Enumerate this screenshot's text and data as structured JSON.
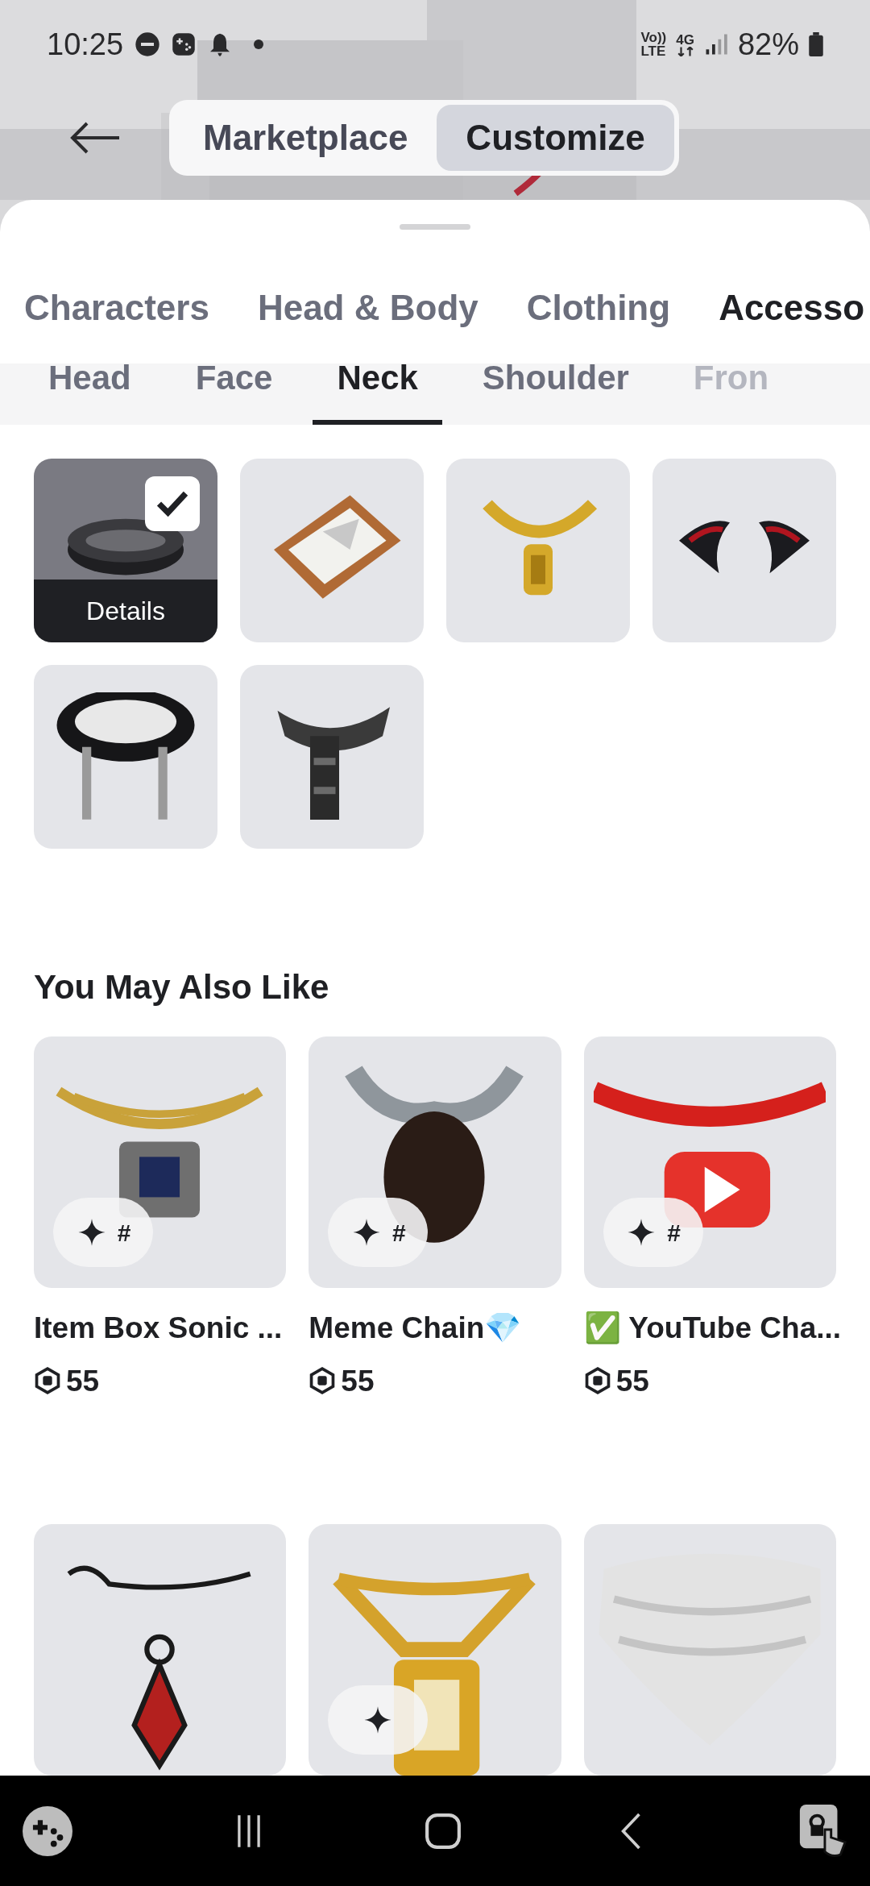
{
  "status_bar": {
    "time": "10:25",
    "volte": [
      "Vo))",
      "LTE"
    ],
    "network": "4G",
    "battery": "82%"
  },
  "header": {
    "tabs": [
      {
        "label": "Marketplace",
        "selected": false
      },
      {
        "label": "Customize",
        "selected": true
      }
    ]
  },
  "categories": [
    {
      "label": "Characters",
      "selected": false
    },
    {
      "label": "Head & Body",
      "selected": false
    },
    {
      "label": "Clothing",
      "selected": false
    },
    {
      "label": "Accesso",
      "selected": true
    }
  ],
  "subcategories": [
    {
      "label": "Head",
      "selected": false
    },
    {
      "label": "Face",
      "selected": false
    },
    {
      "label": "Neck",
      "selected": true
    },
    {
      "label": "Shoulder",
      "selected": false
    },
    {
      "label": "Fron",
      "selected": false
    }
  ],
  "items": [
    {
      "checked": true,
      "details": "Details"
    },
    {
      "checked": false
    },
    {
      "checked": false
    },
    {
      "checked": false
    },
    {
      "checked": false
    },
    {
      "checked": false
    }
  ],
  "recommendations": {
    "title": "You May Also Like",
    "items": [
      {
        "name": "Item Box Sonic ...",
        "price": "55",
        "badge": "#"
      },
      {
        "name": "Meme Chain💎",
        "price": "55",
        "badge": "#"
      },
      {
        "name": "✅ YouTube Cha...",
        "price": "55",
        "badge": "#"
      },
      {
        "badge_shown": false
      },
      {
        "badge_shown": true
      },
      {
        "badge_shown": false
      }
    ]
  }
}
